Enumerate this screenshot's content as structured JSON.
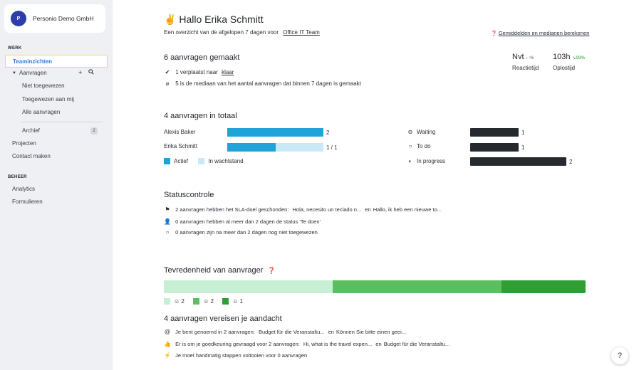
{
  "sidebar": {
    "company": {
      "avatar": "P",
      "name": "Personio Demo GmbH"
    },
    "section_work": "WERK",
    "items": {
      "teaminzichten": "Teaminzichten",
      "aanvragen": "Aanvragen",
      "niet_toegewezen": "Niet toegewezen",
      "toegewezen": "Toegewezen aan mij",
      "alle": "Alle aanvragen",
      "archief": "Archief",
      "archief_count": "2",
      "projecten": "Projecten",
      "contact": "Contact maken"
    },
    "section_beheer": "BEHEER",
    "beheer": {
      "analytics": "Analytics",
      "formulieren": "Formulieren"
    }
  },
  "header": {
    "greeting_emoji": "✌",
    "greeting": "Hallo Erika Schmitt",
    "subtitle": "Een overzicht van de afgelopen 7 dagen voor",
    "team": "Office IT Team",
    "calc_link": "Gemiddelden en medianen berekenen"
  },
  "made": {
    "title": "6 aanvragen gemaakt",
    "line1": "1 verplaatst naar",
    "line1_link": "klaar",
    "line2": "5 is de mediaan van het aantal aanvragen dat binnen 7 dagen is gemaakt",
    "reaction_value": "Nvt",
    "reaction_delta": "– %",
    "reaction_label": "Reactietijd",
    "solve_value": "103h",
    "solve_delta": "↘99%",
    "solve_label": "Oplostijd"
  },
  "total": {
    "title": "4 aanvragen in totaal",
    "people": [
      {
        "name": "Alexis Baker",
        "active": 2,
        "waiting": 0,
        "label": "2"
      },
      {
        "name": "Erika Schmitt",
        "active": 1,
        "waiting": 1,
        "label": "1 / 1"
      }
    ],
    "legend_active": "Actief",
    "legend_waiting": "In wachtstand",
    "statuses": [
      {
        "name": "Waiting",
        "count": 1
      },
      {
        "name": "To do",
        "count": 1
      },
      {
        "name": "In progress",
        "count": 2
      }
    ]
  },
  "status": {
    "title": "Statuscontrole",
    "line1": "2 aanvragen hebben het SLA-doel geschonden:",
    "line1_a": "Hola, necesito un teclado n...",
    "line1_sep": "en",
    "line1_b": "Hallo, ik heb een nieuwe to...",
    "line2": "0 aanvragen hebben al meer dan 2 dagen de status 'Te doen'",
    "line3": "0 aanvragen zijn na meer dan 2 dagen nog niet toegewezen"
  },
  "satisfaction": {
    "title": "Tevredenheid van aanvrager",
    "segments": [
      {
        "count": 2,
        "color": "#c7efd3"
      },
      {
        "count": 2,
        "color": "#5cbf5f"
      },
      {
        "count": 1,
        "color": "#2f9e34"
      }
    ],
    "labels": [
      "2",
      "2",
      "1"
    ]
  },
  "attention": {
    "title": "4 aanvragen vereisen je aandacht",
    "line1": "Je bent genoemd in 2 aanvragen:",
    "line1_a": "Budget für die Veranstaltu...",
    "line1_sep": "en",
    "line1_b": "Können Sie bitte einen geei...",
    "line2": "Er is om je goedkeuring gevraagd voor 2 aanvragen:",
    "line2_a": "Hi, what is the travel expen...",
    "line2_sep": "en",
    "line2_b": "Budget für die Veranstaltu...",
    "line3": "Je moet handmatig stappen voltooien voor 0 aanvragen"
  },
  "help": "?",
  "colors": {
    "active": "#1fa3d8",
    "waiting": "#c9e9f7",
    "accent": "#2b7bd8",
    "highlight": "#f3e33a"
  }
}
